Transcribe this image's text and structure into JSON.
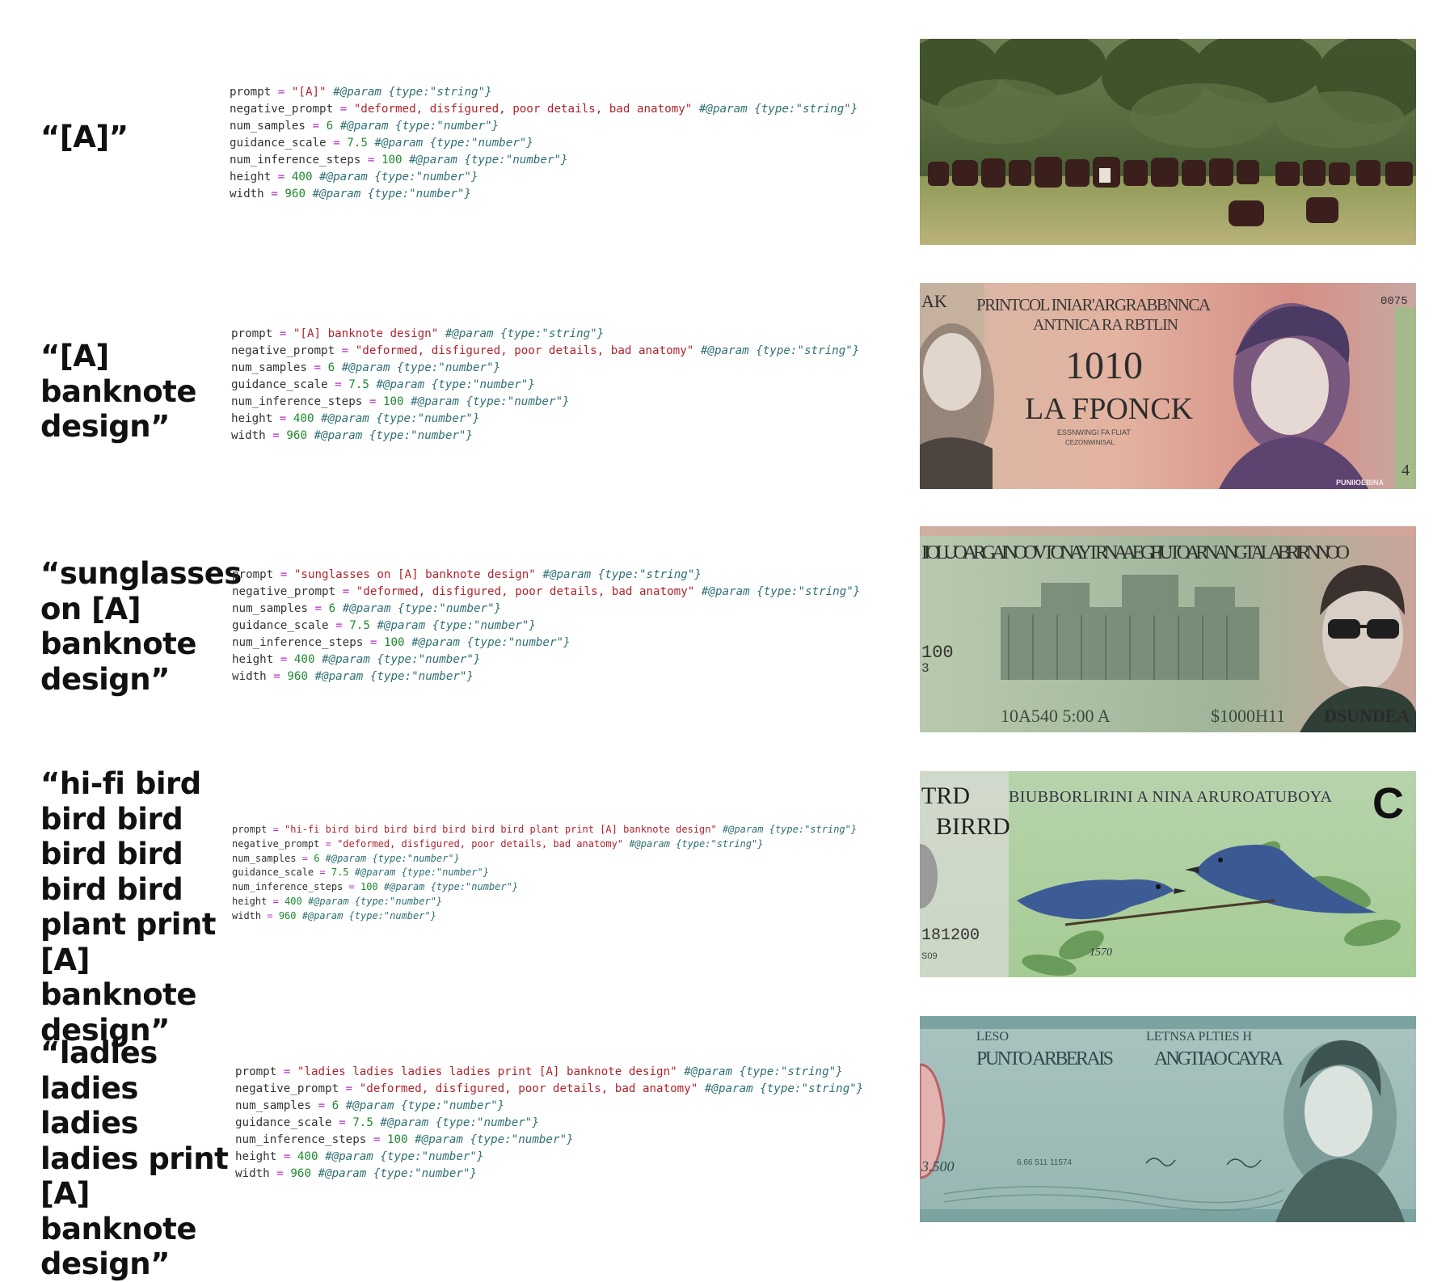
{
  "rows": [
    {
      "caption": "“[A]”",
      "code": {
        "prompt_key": "prompt",
        "prompt_val": "\"[A]\"",
        "prompt_cm": "#@param {type:\"string\"}",
        "neg_key": "negative_prompt",
        "neg_val": "\"deformed, disfigured, poor details, bad anatomy\"",
        "neg_cm": "#@param {type:\"string\"}",
        "ns_key": "num_samples",
        "ns_val": "6",
        "ns_cm": "#@param {type:\"number\"}",
        "gs_key": "guidance_scale",
        "gs_val": "7.5",
        "gs_cm": "#@param {type:\"number\"}",
        "nis_key": "num_inference_steps",
        "nis_val": "100",
        "nis_cm": "#@param {type:\"number\"}",
        "h_key": "height",
        "h_val": "400",
        "h_cm": "#@param {type:\"number\"}",
        "w_key": "width",
        "w_val": "960",
        "w_cm": "#@param {type:\"number\"}"
      },
      "image_label": "cattle-herd-in-field"
    },
    {
      "caption": "“[A] banknote design”",
      "code": {
        "prompt_key": "prompt",
        "prompt_val": "\"[A] banknote design\"",
        "prompt_cm": "#@param {type:\"string\"}",
        "neg_key": "negative_prompt",
        "neg_val": "\"deformed, disfigured, poor details, bad anatomy\"",
        "neg_cm": "#@param {type:\"string\"}",
        "ns_key": "num_samples",
        "ns_val": "6",
        "ns_cm": "#@param {type:\"number\"}",
        "gs_key": "guidance_scale",
        "gs_val": "7.5",
        "gs_cm": "#@param {type:\"number\"}",
        "nis_key": "num_inference_steps",
        "nis_val": "100",
        "nis_cm": "#@param {type:\"number\"}",
        "h_key": "height",
        "h_val": "400",
        "h_cm": "#@param {type:\"number\"}",
        "w_key": "width",
        "w_val": "960",
        "w_cm": "#@param {type:\"number\"}"
      },
      "banknote_text": {
        "top_left": "AK",
        "title1": "PRINTCOL INIAR'ARGRABBNNCA",
        "title2": "ANTNICA RA RBTLIN",
        "denom": "1010",
        "name": "LA FPONCK",
        "sub1": "ESSNWINGI FA FLIAT",
        "sub2": "CEZONWINISAL",
        "serial": "0075",
        "corner": "4",
        "bottom_right": "PUNIIOEBINA"
      }
    },
    {
      "caption": "“sunglasses on [A] banknote design”",
      "code": {
        "prompt_key": "prompt",
        "prompt_val": "\"sunglasses on [A] banknote design\"",
        "prompt_cm": "#@param {type:\"string\"}",
        "neg_key": "negative_prompt",
        "neg_val": "\"deformed, disfigured, poor details, bad anatomy\"",
        "neg_cm": "#@param {type:\"string\"}",
        "ns_key": "num_samples",
        "ns_val": "6",
        "ns_cm": "#@param {type:\"number\"}",
        "gs_key": "guidance_scale",
        "gs_val": "7.5",
        "gs_cm": "#@param {type:\"number\"}",
        "nis_key": "num_inference_steps",
        "nis_val": "100",
        "nis_cm": "#@param {type:\"number\"}",
        "h_key": "height",
        "h_val": "400",
        "h_cm": "#@param {type:\"number\"}",
        "w_key": "width",
        "w_val": "960",
        "w_cm": "#@param {type:\"number\"}"
      },
      "banknote_text": {
        "title": "IIOLUOARGAINOOVTON AYTRNA AE GFIUTO ARNANGT ALA BRIRNNOO",
        "left_num": "100",
        "left_num2": "3",
        "serial_left": "10A540 5:00 A",
        "serial_right": "$1000H11",
        "bottom_right": "DSUNDEA"
      }
    },
    {
      "caption": "“hi-fi bird bird bird bird bird bird bird plant print [A] banknote design”",
      "code": {
        "prompt_key": "prompt",
        "prompt_val": "\"hi-fi bird bird bird bird bird bird bird plant print [A] banknote design\"",
        "prompt_cm": "#@param {type:\"string\"}",
        "neg_key": "negative_prompt",
        "neg_val": "\"deformed, disfigured, poor details, bad anatomy\"",
        "neg_cm": "#@param {type:\"string\"}",
        "ns_key": "num_samples",
        "ns_val": "6",
        "ns_cm": "#@param {type:\"number\"}",
        "gs_key": "guidance_scale",
        "gs_val": "7.5",
        "gs_cm": "#@param {type:\"number\"}",
        "nis_key": "num_inference_steps",
        "nis_val": "100",
        "nis_cm": "#@param {type:\"number\"}",
        "h_key": "height",
        "h_val": "400",
        "h_cm": "#@param {type:\"number\"}",
        "w_key": "width",
        "w_val": "960",
        "w_cm": "#@param {type:\"number\"}"
      },
      "banknote_text": {
        "top_left1": "TRD",
        "top_left2": "BIRRD",
        "title": "BIUBBORLIRINI A NINA ARUROATUBOYA",
        "corner": "C",
        "serial": "181200",
        "serial2": "S09",
        "num": "1570"
      }
    },
    {
      "caption": "“ladies ladies ladies ladies print [A] banknote design”",
      "code": {
        "prompt_key": "prompt",
        "prompt_val": "\"ladies ladies ladies ladies print [A] banknote design\"",
        "prompt_cm": "#@param {type:\"string\"}",
        "neg_key": "negative_prompt",
        "neg_val": "\"deformed, disfigured, poor details, bad anatomy\"",
        "neg_cm": "#@param {type:\"string\"}",
        "ns_key": "num_samples",
        "ns_val": "6",
        "ns_cm": "#@param {type:\"number\"}",
        "gs_key": "guidance_scale",
        "gs_val": "7.5",
        "gs_cm": "#@param {type:\"number\"}",
        "nis_key": "num_inference_steps",
        "nis_val": "100",
        "nis_cm": "#@param {type:\"number\"}",
        "h_key": "height",
        "h_val": "400",
        "h_cm": "#@param {type:\"number\"}",
        "w_key": "width",
        "w_val": "960",
        "w_cm": "#@param {type:\"number\"}"
      },
      "banknote_text": {
        "t1a": "LESO",
        "t1b": "PUNTO ARBERAIS",
        "t2a": "LETNSA PLTIES H",
        "t2b": "ANGTIAO CAYRA",
        "serial": "3.500",
        "serial2": "6.66 511 11574"
      }
    }
  ],
  "colors": {
    "code_key": "#333333",
    "code_operator": "#b62cc8",
    "code_string": "#b0232d",
    "code_number": "#1f8a2e",
    "code_comment": "#2f6f74"
  }
}
